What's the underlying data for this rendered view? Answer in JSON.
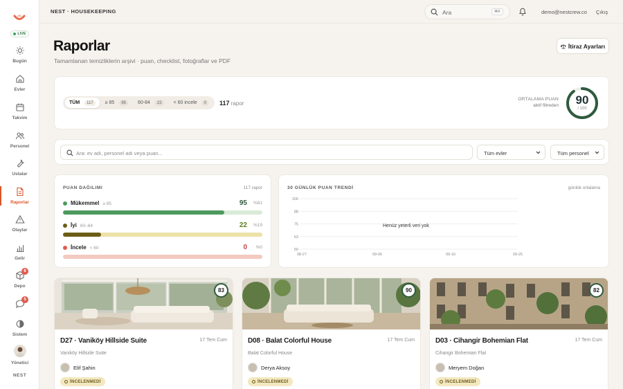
{
  "sidebar": {
    "live": "LIVE",
    "items": [
      {
        "label": "Bugün",
        "icon": "sun-icon"
      },
      {
        "label": "Evler",
        "icon": "home-icon"
      },
      {
        "label": "Takvim",
        "icon": "calendar-icon"
      },
      {
        "label": "Personel",
        "icon": "users-icon"
      },
      {
        "label": "Ustalar",
        "icon": "wrench-icon"
      },
      {
        "label": "Raporlar",
        "icon": "report-icon",
        "active": true
      },
      {
        "label": "Olaylar",
        "icon": "warning-icon"
      },
      {
        "label": "Gelir",
        "icon": "bar-chart-icon"
      },
      {
        "label": "Depo",
        "icon": "box-icon",
        "badge": "6"
      },
      {
        "label": "",
        "icon": "chat-icon",
        "badge": "5"
      },
      {
        "label": "Sistem",
        "icon": "theme-icon"
      }
    ],
    "user_label": "Yönetici",
    "footer": "NEST"
  },
  "topbar": {
    "brand": "NEST · HOUSEKEEPING",
    "search_placeholder": "Ara",
    "search_kbd": "⌘K",
    "email": "demo@nestcrew.co",
    "logout": "Çıkış"
  },
  "page": {
    "title": "Raporlar",
    "subtitle": "Tamamlanan temizliklerin arşivi · puan, checklist, fotoğraflar ve PDF",
    "objection_button": "İtiraz Ayarları"
  },
  "filters": [
    {
      "label": "TÜM",
      "count": "117",
      "active": true
    },
    {
      "label": "≥ 85",
      "count": "95"
    },
    {
      "label": "60-84",
      "count": "22"
    },
    {
      "label": "< 60 incele",
      "count": "0"
    }
  ],
  "summary": {
    "count": "117",
    "count_suffix": "rapor",
    "avg_label": "ORTALAMA PUAN",
    "avg_sub": "aktif filtreden",
    "avg_value": "90",
    "avg_den": "/ 100",
    "avg_fraction": 0.9
  },
  "search2": {
    "placeholder": "Ara: ev adı, personel adı veya puan...",
    "homes": "Tüm evler",
    "staff": "Tüm personel"
  },
  "distribution": {
    "title": "PUAN DAĞILIMI",
    "right": "117 rapor",
    "rows": [
      {
        "label": "Mükemmel",
        "range": "≥ 85",
        "value": "95",
        "pct": "%81",
        "fraction": 0.81,
        "color": "#4e9a5e",
        "track": "#d9ebd8"
      },
      {
        "label": "İyi",
        "range": "60–84",
        "value": "22",
        "pct": "%19",
        "fraction": 0.19,
        "color": "#6b5d16",
        "track": "#ece2a8"
      },
      {
        "label": "İncele",
        "range": "< 60",
        "value": "0",
        "pct": "%0",
        "fraction": 0,
        "color": "#e05b4f",
        "track": "#f3c9c0"
      }
    ]
  },
  "trend": {
    "title": "30 GÜNLÜK PUAN TRENDİ",
    "right": "günlük ortalama",
    "empty": "Henüz yeterli veri yok"
  },
  "chart_data": {
    "type": "line",
    "title": "30 GÜNLÜK PUAN TRENDİ",
    "y_ticks": [
      "100",
      "88",
      "75",
      "63",
      "50"
    ],
    "x_ticks": [
      "08-27",
      "09-06",
      "09-16",
      "09-25"
    ],
    "ylim": [
      50,
      100
    ],
    "series": [],
    "grid": true
  },
  "reports": [
    {
      "title": "D27 · Vaniköy Hillside Suite",
      "date": "17 Tem Cum",
      "sub": "Vaniköy Hillside Suite",
      "person": "Elif Şahin",
      "score": "83",
      "status": "İNCELENMEDİ"
    },
    {
      "title": "D08 · Balat Colorful House",
      "date": "17 Tem Cum",
      "sub": "Balat Colorful House",
      "person": "Derya Aksoy",
      "score": "90",
      "status": "İNCELENMEDİ"
    },
    {
      "title": "D03 · Cihangir Bohemian Flat",
      "date": "17 Tem Cum",
      "sub": "Cihangir Bohemian Flat",
      "person": "Meryem Doğan",
      "score": "82",
      "status": "İNCELENMEDİ"
    }
  ]
}
